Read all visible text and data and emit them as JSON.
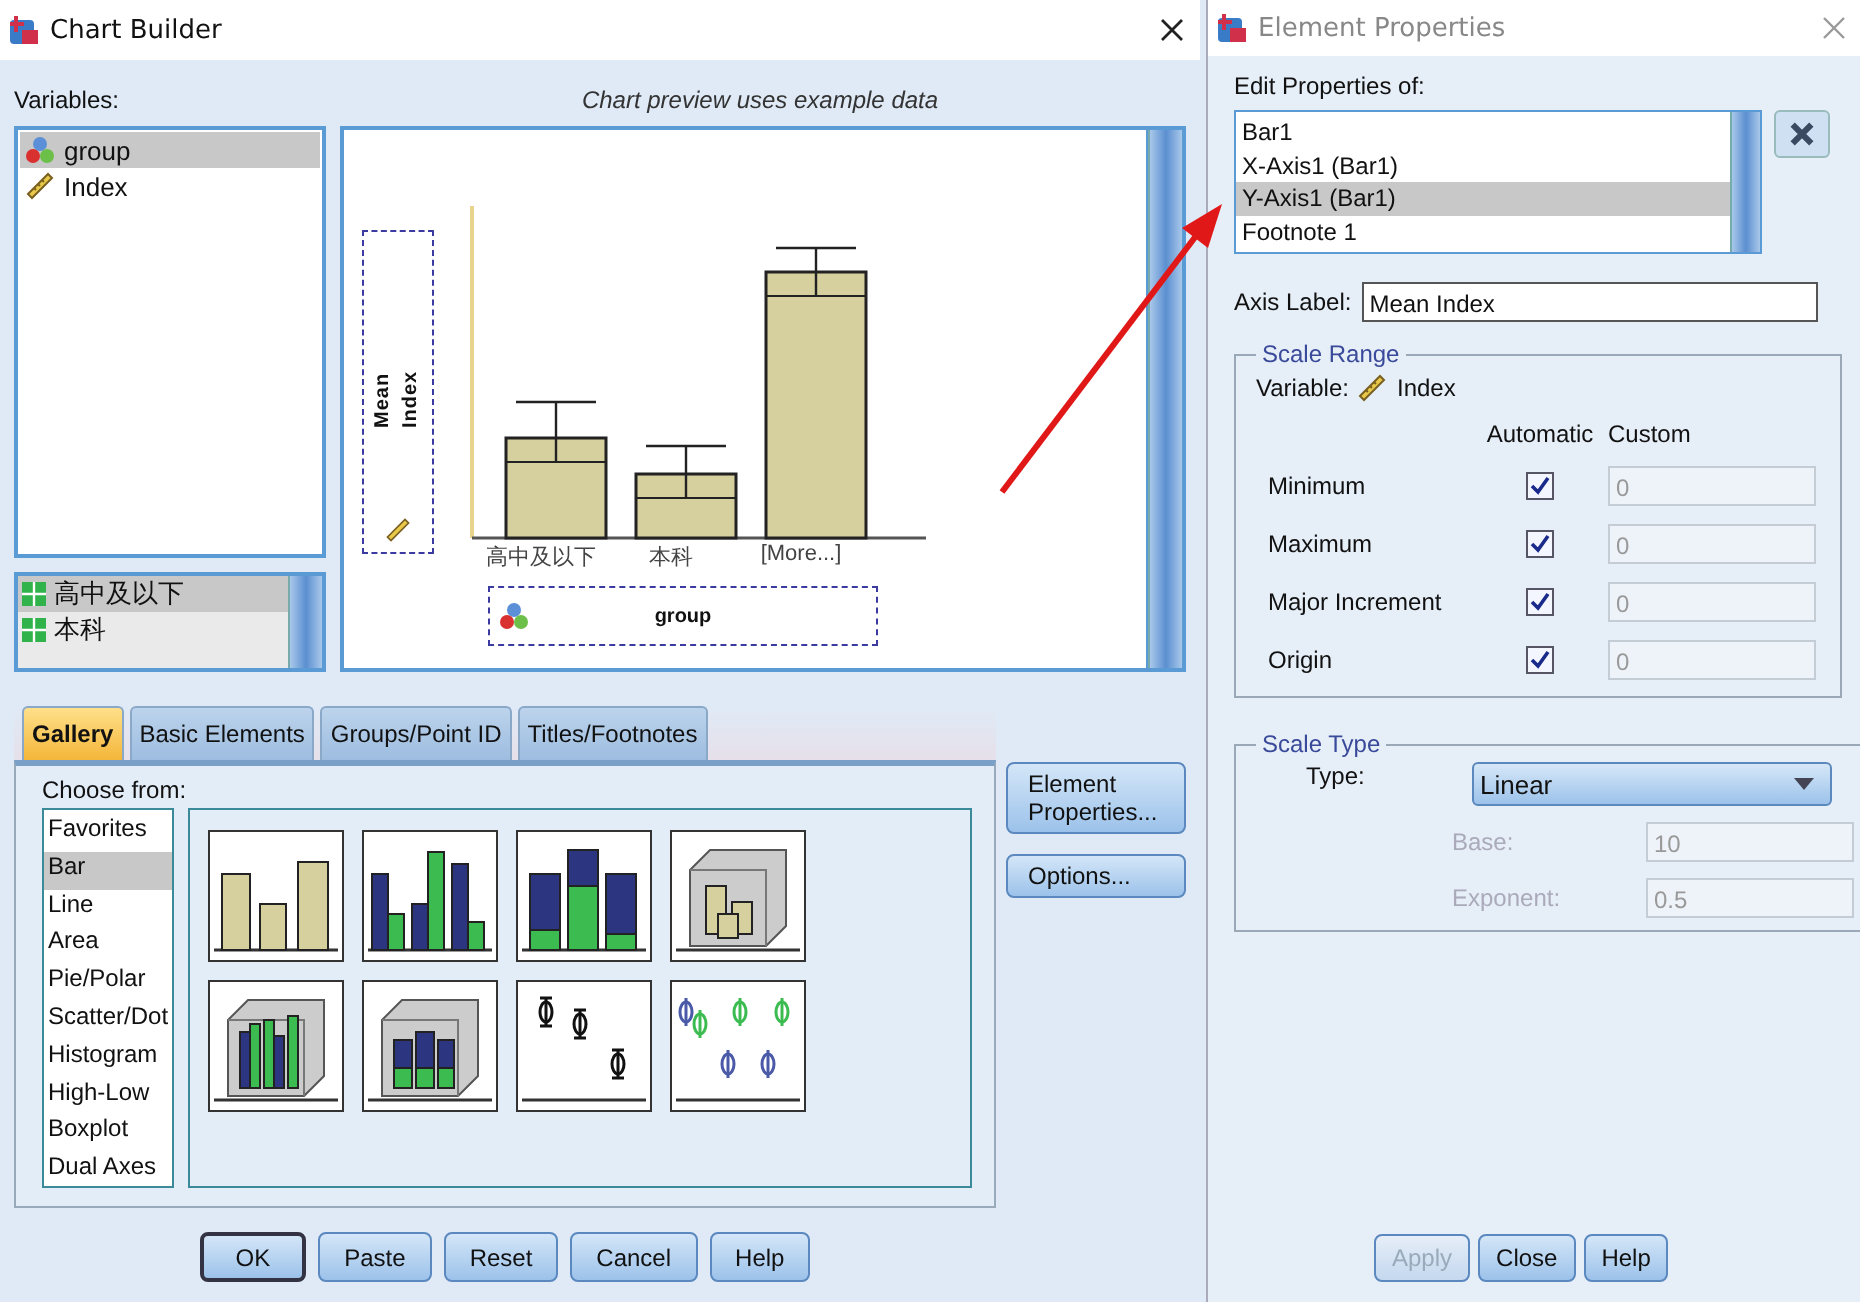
{
  "chart_builder": {
    "window": {
      "title": "Chart Builder"
    },
    "variables_label": "Variables:",
    "variables": [
      {
        "name": "group",
        "kind": "nominal",
        "selected": true
      },
      {
        "name": "Index",
        "kind": "scale",
        "selected": false
      }
    ],
    "categories": [
      {
        "label": "高中及以下",
        "selected": true
      },
      {
        "label": "本科",
        "selected": false
      }
    ],
    "preview": {
      "caption": "Chart preview uses example data",
      "y_axis_label": "Mean Index",
      "categories": [
        "高中及以下",
        "本科",
        "[More...]"
      ],
      "x_variable": "group"
    },
    "tabs": [
      {
        "label": "Gallery",
        "selected": true
      },
      {
        "label": "Basic Elements",
        "selected": false
      },
      {
        "label": "Groups/Point ID",
        "selected": false
      },
      {
        "label": "Titles/Footnotes",
        "selected": false
      }
    ],
    "choose_from_label": "Choose from:",
    "chart_types": [
      {
        "label": "Favorites",
        "selected": false
      },
      {
        "label": "Bar",
        "selected": true
      },
      {
        "label": "Line",
        "selected": false
      },
      {
        "label": "Area",
        "selected": false
      },
      {
        "label": "Pie/Polar",
        "selected": false
      },
      {
        "label": "Scatter/Dot",
        "selected": false
      },
      {
        "label": "Histogram",
        "selected": false
      },
      {
        "label": "High-Low",
        "selected": false
      },
      {
        "label": "Boxplot",
        "selected": false
      },
      {
        "label": "Dual Axes",
        "selected": false
      }
    ],
    "gallery": [
      {
        "kind": "simple"
      },
      {
        "kind": "clustered"
      },
      {
        "kind": "stacked"
      },
      {
        "kind": "simple3d"
      },
      {
        "kind": "clustered3d"
      },
      {
        "kind": "stacked3d"
      },
      {
        "kind": "errorbar"
      },
      {
        "kind": "errorbar_clustered"
      }
    ],
    "side_buttons": [
      "Element Properties...",
      "Options..."
    ],
    "buttons": [
      "OK",
      "Paste",
      "Reset",
      "Cancel",
      "Help"
    ]
  },
  "element_properties": {
    "window": {
      "title": "Element Properties"
    },
    "edit_label": "Edit Properties of:",
    "elements": [
      {
        "label": "Bar1",
        "selected": false
      },
      {
        "label": "X-Axis1 (Bar1)",
        "selected": false
      },
      {
        "label": "Y-Axis1 (Bar1)",
        "selected": true
      },
      {
        "label": "Footnote 1",
        "selected": false
      }
    ],
    "axis_label": {
      "label": "Axis Label:",
      "value": "Mean Index"
    },
    "scale_range": {
      "title": "Scale Range",
      "variable_label": "Variable:",
      "variable": "Index",
      "columns": [
        "Automatic",
        "Custom"
      ],
      "rows": [
        {
          "label": "Minimum",
          "checked": true,
          "value": "0"
        },
        {
          "label": "Maximum",
          "checked": true,
          "value": "0"
        },
        {
          "label": "Major Increment",
          "checked": true,
          "value": "0"
        },
        {
          "label": "Origin",
          "checked": true,
          "value": "0"
        }
      ]
    },
    "scale_type": {
      "title": "Scale Type",
      "type_label": "Type:",
      "type": "Linear",
      "fields": [
        {
          "label": "Base:",
          "value": "10",
          "disabled": true
        },
        {
          "label": "Exponent:",
          "value": "0.5",
          "disabled": true
        }
      ]
    },
    "buttons": [
      {
        "label": "Apply",
        "disabled": true
      },
      {
        "label": "Close",
        "disabled": false
      },
      {
        "label": "Help",
        "disabled": false
      }
    ]
  }
}
